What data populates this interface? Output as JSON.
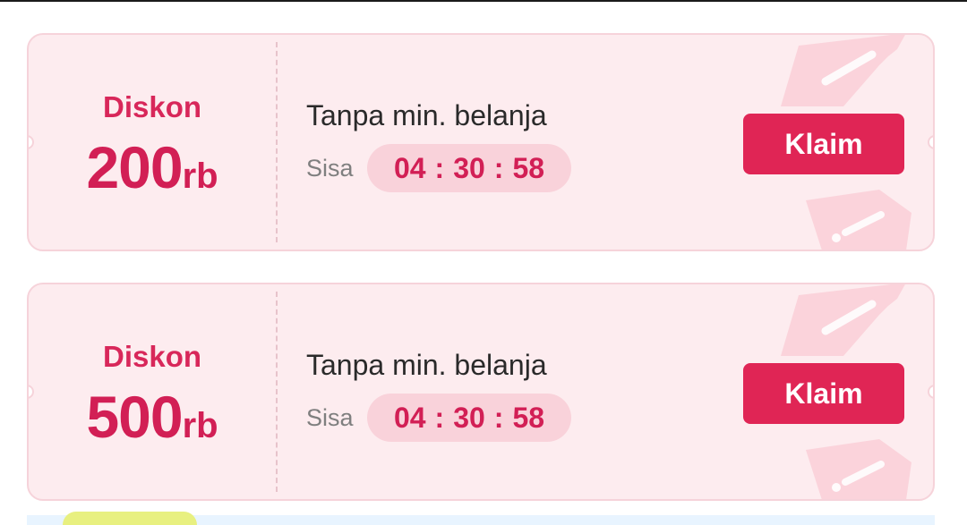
{
  "colors": {
    "accent": "#e02555",
    "coupon_bg": "#fdecef",
    "coupon_border": "#f6d3da",
    "timer_bg": "#f9d2da",
    "muted_text": "#7f7f7f"
  },
  "coupons": [
    {
      "discount_label": "Diskon",
      "amount": "200",
      "unit": "rb",
      "condition": "Tanpa min. belanja",
      "remaining_label": "Sisa",
      "timer": {
        "hours": "04",
        "minutes": "30",
        "seconds": "58",
        "separator": ":"
      },
      "claim_label": "Klaim",
      "decoration_icon": "coupon-ticket-icon"
    },
    {
      "discount_label": "Diskon",
      "amount": "500",
      "unit": "rb",
      "condition": "Tanpa min. belanja",
      "remaining_label": "Sisa",
      "timer": {
        "hours": "04",
        "minutes": "30",
        "seconds": "58",
        "separator": ":"
      },
      "claim_label": "Klaim",
      "decoration_icon": "coupon-ticket-icon"
    }
  ]
}
